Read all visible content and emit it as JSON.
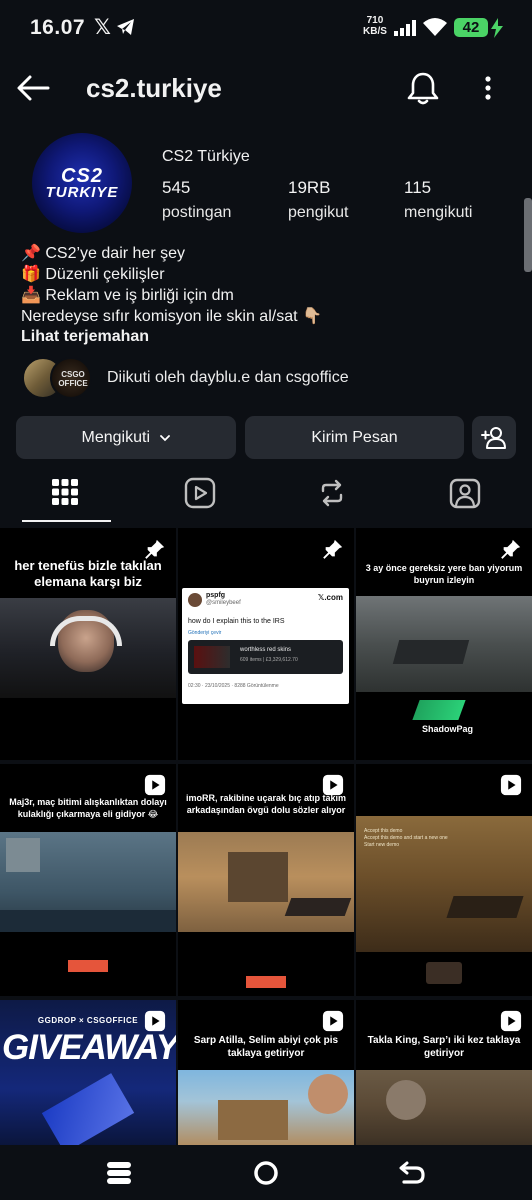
{
  "status_bar": {
    "time": "16.07",
    "x_label": "𝕏",
    "speed_value": "710",
    "speed_unit": "KB/S",
    "battery": "42"
  },
  "header": {
    "username": "cs2.turkiye"
  },
  "profile": {
    "avatar_line1": "CS2",
    "avatar_line2": "TURKIYE",
    "display_name": "CS2 Türkiye",
    "stats": [
      {
        "value": "545",
        "label": "postingan"
      },
      {
        "value": "19RB",
        "label": "pengikut"
      },
      {
        "value": "115",
        "label": "mengikuti"
      }
    ],
    "bio": [
      "📌 CS2’ye dair her şey",
      "🎁 Düzenli çekilişler",
      "📥 Reklam ve iş birliği için dm",
      "Neredeyse sıfır komisyon ile skin al/sat 👇🏼"
    ],
    "translate": "Lihat terjemahan",
    "followed_by_avatar2": "CSGO OFFICE",
    "followed_by": "Diikuti oleh dayblu.e dan csgoffice"
  },
  "actions": {
    "follow": "Mengikuti",
    "message": "Kirim Pesan"
  },
  "posts": [
    {
      "caption": "her tenefüs bizle takılan elemana karşı biz",
      "badge": "pin"
    },
    {
      "caption": "",
      "badge": "pin",
      "tweet": {
        "name": "pspfg",
        "handle": "@smileybeef",
        "brand": "𝕏.com",
        "text": "how do I explain this to the IRS",
        "translate": "Gönderiyi çevir",
        "item_title": "worthless red skins",
        "item_sub": "609 items | £3,329,612.70",
        "footer": "02:30 · 23/10/2025 · 8288 Görüntülenme"
      }
    },
    {
      "caption": "3 ay önce gereksiz yere ban yiyorum buyrun izleyin",
      "badge": "pin",
      "logo": "ShadowPag"
    },
    {
      "caption": "Maj3r, maç bitimi alışkanlıktan dolayı kulaklığı çıkarmaya eli gidiyor 😂",
      "badge": "reel"
    },
    {
      "caption": "imoRR, rakibine uçarak bıç atıp takım arkadaşından övgü dolu sözler alıyor",
      "badge": "reel"
    },
    {
      "caption": "",
      "badge": "reel",
      "console": [
        "Accept this demo",
        "Accept this demo and start a new one",
        "Start new demo"
      ]
    },
    {
      "caption": "GIVEAWAY",
      "badge": "reel",
      "brands": "GGDROP × CSGOFFICE"
    },
    {
      "caption": "Sarp Atilla, Selim abiyi çok pis taklaya getiriyor",
      "badge": "reel"
    },
    {
      "caption": "Takla King, Sarp’ı iki kez taklaya getiriyor",
      "badge": "reel"
    }
  ]
}
